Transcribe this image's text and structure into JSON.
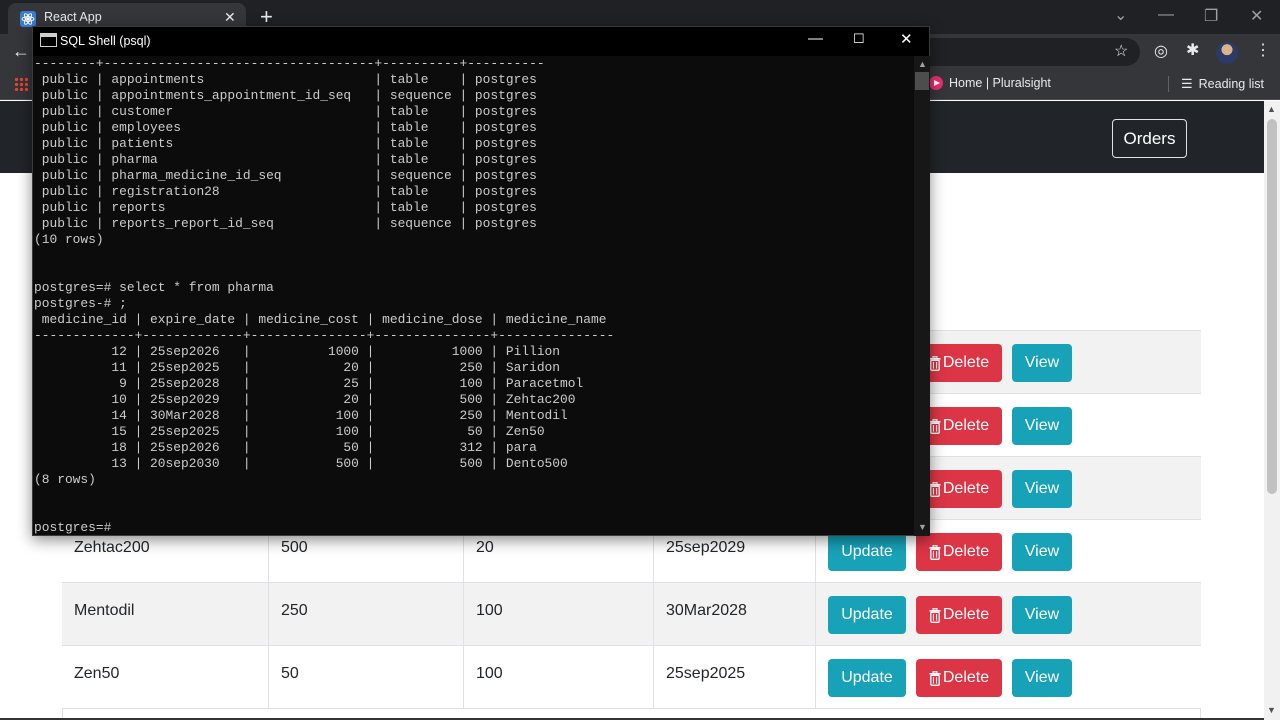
{
  "browser": {
    "tab_title": "React App",
    "tab_close": "✕",
    "new_tab": "+",
    "bookmarks": [
      {
        "label": "Home | Pluralsight"
      },
      {
        "label": "Reading list"
      }
    ]
  },
  "navbar": {
    "orders_label": "Orders"
  },
  "table": {
    "rows": [
      {
        "name": "",
        "dose": "",
        "cost": "",
        "expiry": ""
      },
      {
        "name": "",
        "dose": "",
        "cost": "",
        "expiry": ""
      },
      {
        "name": "",
        "dose": "",
        "cost": "",
        "expiry": ""
      },
      {
        "name": "Zehtac200",
        "dose": "500",
        "cost": "20",
        "expiry": "25sep2029"
      },
      {
        "name": "Mentodil",
        "dose": "250",
        "cost": "100",
        "expiry": "30Mar2028"
      },
      {
        "name": "Zen50",
        "dose": "50",
        "cost": "100",
        "expiry": "25sep2025"
      }
    ],
    "update_label": "Update",
    "delete_label": "Delete",
    "view_label": "View"
  },
  "console": {
    "title": "SQL Shell (psql)",
    "lines": [
      "--------+-----------------------------------+----------+----------",
      " public | appointments                      | table    | postgres",
      " public | appointments_appointment_id_seq   | sequence | postgres",
      " public | customer                          | table    | postgres",
      " public | employees                         | table    | postgres",
      " public | patients                          | table    | postgres",
      " public | pharma                            | table    | postgres",
      " public | pharma_medicine_id_seq            | sequence | postgres",
      " public | registration28                    | table    | postgres",
      " public | reports                           | table    | postgres",
      " public | reports_report_id_seq             | sequence | postgres",
      "(10 rows)",
      "",
      "",
      "postgres=# select * from pharma",
      "postgres-# ;",
      " medicine_id | expire_date | medicine_cost | medicine_dose | medicine_name",
      "-------------+-------------+---------------+---------------+---------------",
      "          12 | 25sep2026   |          1000 |          1000 | Pillion",
      "          11 | 25sep2025   |            20 |           250 | Saridon",
      "           9 | 25sep2028   |            25 |           100 | Paracetmol",
      "          10 | 25sep2029   |            20 |           500 | Zehtac200",
      "          14 | 30Mar2028   |           100 |           250 | Mentodil",
      "          15 | 25sep2025   |           100 |            50 | Zen50",
      "          18 | 25sep2026   |            50 |           312 | para",
      "          13 | 20sep2030   |           500 |           500 | Dento500",
      "(8 rows)",
      "",
      "",
      "postgres=#"
    ]
  }
}
